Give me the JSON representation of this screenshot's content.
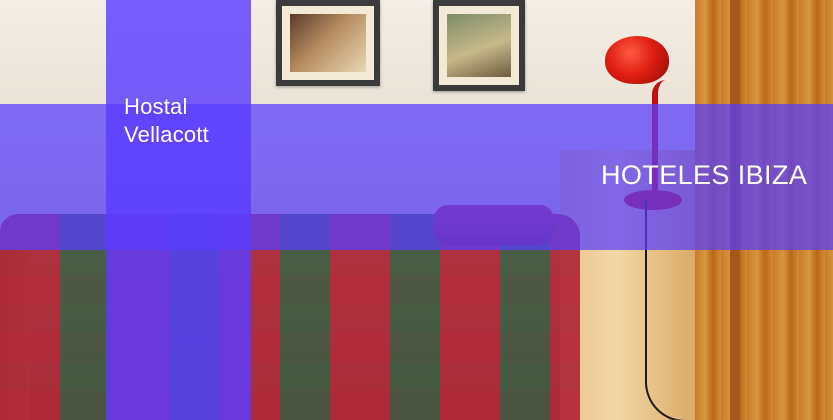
{
  "brand": {
    "name": "Hostal Vellacott"
  },
  "category": {
    "label": "HOTELES IBIZA"
  },
  "colors": {
    "overlay": "#5a3cff",
    "text": "#ffffff"
  }
}
